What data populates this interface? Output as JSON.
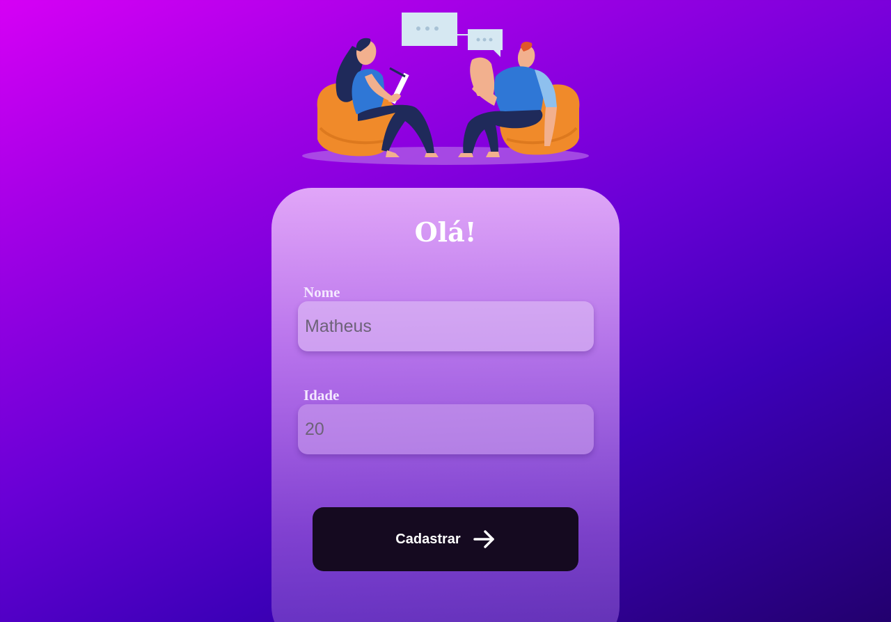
{
  "card": {
    "title": "Olá!"
  },
  "form": {
    "name_label": "Nome",
    "name_value": "Matheus",
    "age_label": "Idade",
    "age_value": "20",
    "submit_label": "Cadastrar",
    "submit_icon": "arrow-right-icon"
  },
  "colors": {
    "background_start": "#d600f5",
    "background_end": "#22006e",
    "button": "#150a20",
    "pouf": "#f08a2a",
    "shirt": "#2f77d6",
    "pants": "#1f2a5a"
  }
}
